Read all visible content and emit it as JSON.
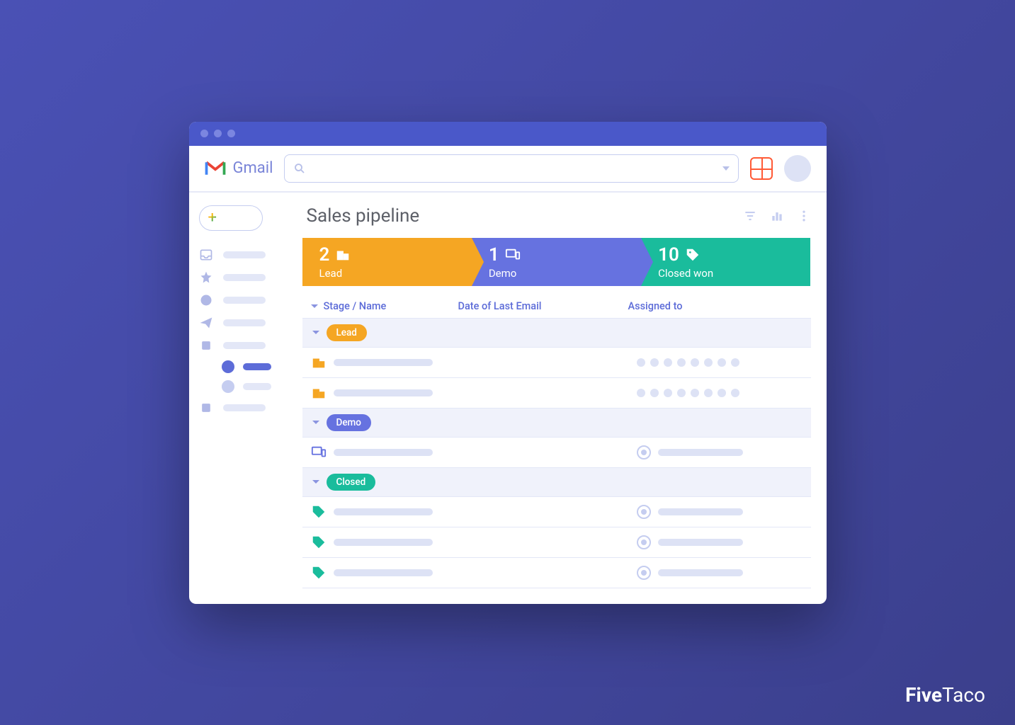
{
  "app": {
    "name": "Gmail"
  },
  "page_title": "Sales pipeline",
  "pipeline_stages": [
    {
      "count": 2,
      "label": "Lead",
      "color": "yellow"
    },
    {
      "count": 1,
      "label": "Demo",
      "color": "blue"
    },
    {
      "count": 10,
      "label": "Closed won",
      "color": "teal"
    }
  ],
  "columns": {
    "stage": "Stage / Name",
    "date": "Date of Last Email",
    "assigned": "Assigned to"
  },
  "groups": [
    {
      "label": "Lead",
      "pill": "yellow",
      "row_icon": "building",
      "row_icon_color": "#f5a623",
      "assigned_style": "dots",
      "rows": 2
    },
    {
      "label": "Demo",
      "pill": "blue",
      "row_icon": "screen",
      "row_icon_color": "#6672e0",
      "assigned_style": "user",
      "rows": 1
    },
    {
      "label": "Closed",
      "pill": "teal",
      "row_icon": "tag",
      "row_icon_color": "#1abc9c",
      "assigned_style": "user",
      "rows": 3
    }
  ],
  "watermark": "FiveTaco"
}
